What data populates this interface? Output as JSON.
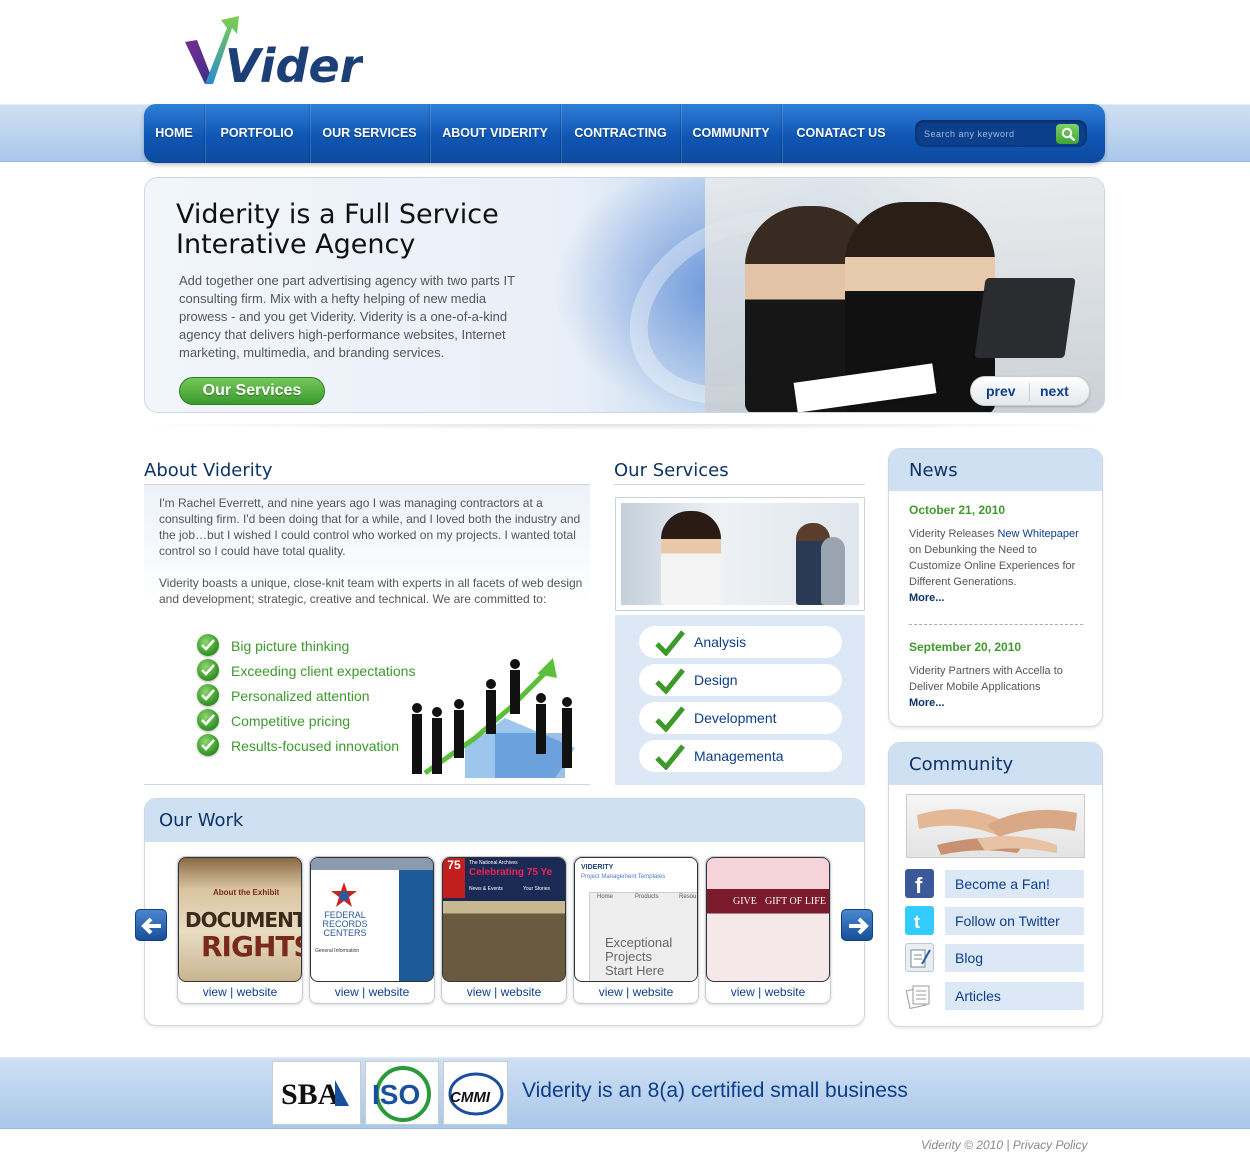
{
  "brand": {
    "name": "Viderity"
  },
  "nav": {
    "items": [
      "HOME",
      "PORTFOLIO",
      "OUR SERVICES",
      "ABOUT VIDERITY",
      "CONTRACTING",
      "COMMUNITY",
      "CONATACT US"
    ],
    "search_placeholder": "Search any keyword"
  },
  "hero": {
    "title_line1": "Viderity is a Full Service",
    "title_line2": "Interative Agency",
    "text": "Add together one part advertising agency with two parts IT consulting firm. Mix with a hefty helping of new media prowess - and you get Viderity. Viderity is a one-of-a-kind agency that delivers high-performance websites, Internet marketing, multimedia, and branding services.",
    "button": "Our Services",
    "prev": "prev",
    "next": "next"
  },
  "about": {
    "heading": "About Viderity",
    "p1": "I'm Rachel Everrett, and nine years ago I was managing contractors at a consulting firm. I'd been doing that for a while, and I loved both the industry and the job…but I wished I could control who worked on my projects. I wanted total control so I could have total quality.",
    "p2": "Viderity boasts a unique, close-knit team with experts in all facets of web design and development; strategic, creative and technical. We are committed to:",
    "points": [
      "Big picture thinking",
      "Exceeding client expectations",
      "Personalized attention",
      "Competitive pricing",
      "Results-focused innovation"
    ]
  },
  "services": {
    "heading": "Our Services",
    "items": [
      "Analysis",
      "Design",
      "Development",
      "Managementa"
    ]
  },
  "work": {
    "heading": "Our Work",
    "view": "view",
    "sep": " | ",
    "website": "website",
    "thumbs": [
      {
        "line1": "About the Exhibit",
        "line2": "DOCUMENTED",
        "line3": "RIGHTS"
      },
      {
        "line1": "FEDERAL",
        "line2": "RECORDS",
        "line3": "CENTERS",
        "line4": "General Information"
      },
      {
        "line1": "The National Archives",
        "line2": "Celebrating 75 Ye",
        "line3": "News & Events",
        "line4": "Your Stories"
      },
      {
        "line1": "VIDERITY",
        "line2": "Project Management Templates",
        "line3": "Exceptional",
        "line4": "Projects",
        "line5": "Start Here",
        "tab1": "Home",
        "tab2": "Products",
        "tab3": "Resou"
      },
      {
        "line1": "GIVE",
        "line2": "GIFT OF LIFE"
      }
    ]
  },
  "news": {
    "heading": "News",
    "items": [
      {
        "date": "October 21, 2010",
        "pre": "Viderity Releases ",
        "link": "New Whitepaper",
        "post": " on Debunking the Need to Customize Online Experiences for Different Generations.",
        "more": "More..."
      },
      {
        "date": "September 20, 2010",
        "pre": "Viderity Partners with Accella to Deliver Mobile Applications",
        "link": "",
        "post": "",
        "more": "More..."
      }
    ]
  },
  "community": {
    "heading": "Community",
    "items": [
      "Become a Fan!",
      "Follow on Twitter",
      "Blog",
      "Articles"
    ]
  },
  "footer": {
    "logos": [
      "SBA",
      "ISO",
      "CMMI"
    ],
    "cert": "Viderity is an 8(a) certified small business",
    "copyright": "Viderity © 2010 | Privacy Policy"
  }
}
